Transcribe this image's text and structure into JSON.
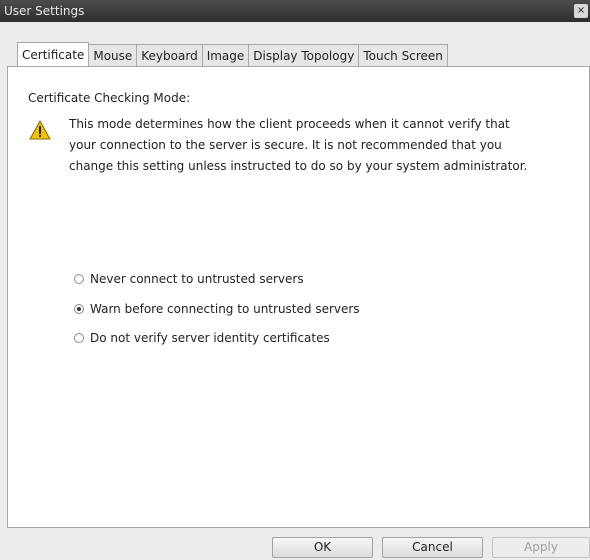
{
  "window": {
    "title": "User Settings",
    "close_glyph": "×"
  },
  "tabs": [
    {
      "label": "Certificate",
      "active": true
    },
    {
      "label": "Mouse",
      "active": false
    },
    {
      "label": "Keyboard",
      "active": false
    },
    {
      "label": "Image",
      "active": false
    },
    {
      "label": "Display Topology",
      "active": false
    },
    {
      "label": "Touch Screen",
      "active": false
    }
  ],
  "certificate": {
    "heading": "Certificate Checking Mode:",
    "warning_icon": "warning-triangle-icon",
    "description": [
      "This mode determines how the client proceeds when it cannot verify that",
      "your connection to the server is secure. It is not recommended that you",
      "change this setting unless instructed to do so by your system administrator."
    ],
    "options": [
      {
        "label": "Never connect to untrusted servers",
        "selected": false
      },
      {
        "label": "Warn before connecting to untrusted servers",
        "selected": true
      },
      {
        "label": "Do not verify server identity certificates",
        "selected": false
      }
    ]
  },
  "buttons": {
    "ok": "OK",
    "cancel": "Cancel",
    "apply": "Apply",
    "apply_disabled": true
  },
  "colors": {
    "titlebar": "#3a3a3a",
    "warning_fill": "#f2c200"
  }
}
